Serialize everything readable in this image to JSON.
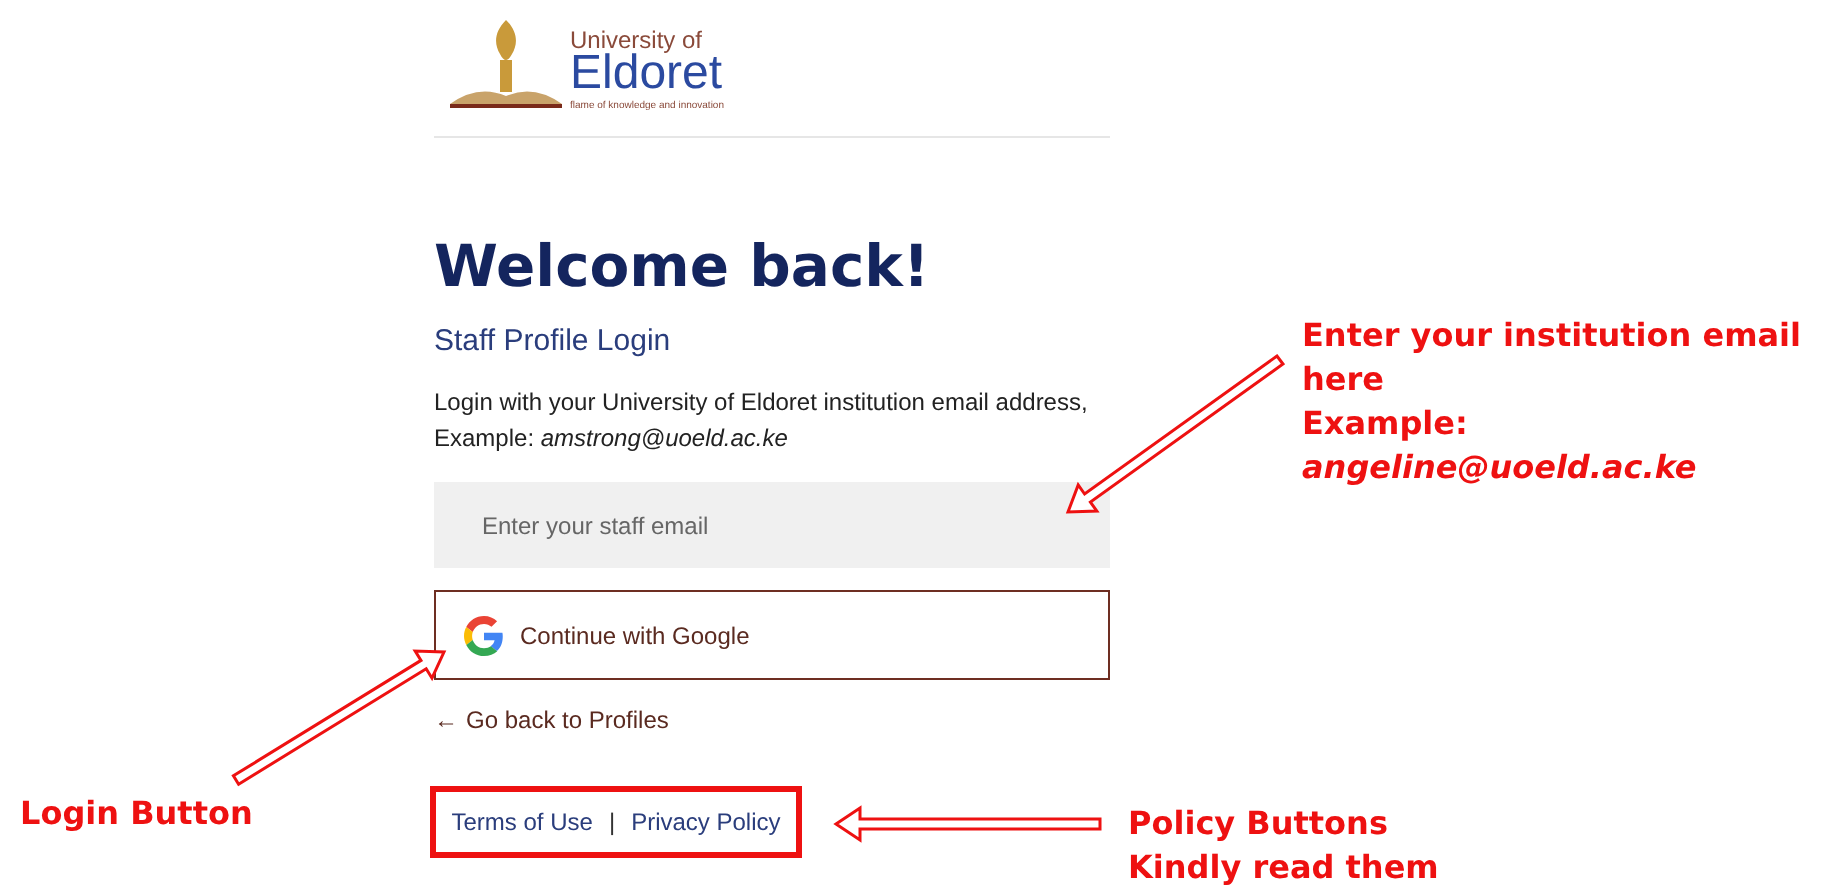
{
  "logo": {
    "line_1": "University of",
    "line_2": "Eldoret",
    "tagline": "flame of knowledge and innovation"
  },
  "heading": "Welcome back!",
  "subtitle": "Staff Profile Login",
  "intro": "Login with your University of Eldoret institution email address, Example: *amstrong@uoeld.ac.ke*",
  "email_field": {
    "placeholder": "Enter your staff email"
  },
  "google_button": {
    "label": "Continue with Google"
  },
  "back_link": {
    "arrow": "←",
    "label": "Go back to Profiles"
  },
  "footer_links": [
    {
      "label": "Terms of Use"
    },
    {
      "label": "Privacy Policy"
    }
  ],
  "footer_separator": "|",
  "annotations": [
    {
      "kind": "email",
      "lines": [
        {
          "text": "Enter your institution email",
          "kind": "plain"
        },
        {
          "text": "here",
          "kind": "plain"
        },
        {
          "text": "Example:",
          "kind": "plain"
        },
        {
          "text": "angeline@uoeld.ac.ke",
          "kind": "emphasis"
        }
      ]
    },
    {
      "kind": "login",
      "lines": [
        {
          "text": "Login Button",
          "kind": "plain"
        }
      ]
    },
    {
      "kind": "policy",
      "lines": [
        {
          "text": "Policy Buttons",
          "kind": "plain"
        },
        {
          "text": "Kindly read them",
          "kind": "plain"
        }
      ]
    }
  ]
}
